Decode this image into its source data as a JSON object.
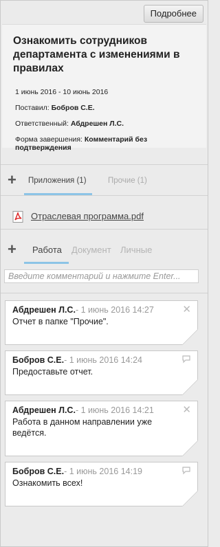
{
  "header": {
    "more_button": "Подробнее"
  },
  "task": {
    "title": "Ознакомить сотрудников департамента с изменениями в правилах",
    "dates": "1 июнь 2016 - 10 июнь 2016",
    "assigned_by_label": "Поставил:",
    "assigned_by": "Бобров С.Е.",
    "responsible_label": "Ответственный:",
    "responsible": "Абдрешен Л.С.",
    "completion_label": "Форма завершения:",
    "completion": "Комментарий без подтверждения"
  },
  "attachments": {
    "tabs": [
      {
        "label": "Приложения (1)",
        "active": true
      },
      {
        "label": "Прочие (1)",
        "active": false
      }
    ],
    "files": [
      {
        "name": "Отраслевая программа.pdf",
        "icon": "pdf-icon"
      }
    ]
  },
  "comments_section": {
    "tabs": [
      {
        "label": "Работа",
        "active": true
      },
      {
        "label": "Документ",
        "active": false
      },
      {
        "label": "Личные",
        "active": false
      }
    ],
    "input_placeholder": "Введите комментарий и нажмите Enter...",
    "items": [
      {
        "author": "Абдрешен Л.С.",
        "sep": "-",
        "date": "1 июнь 2016 14:27",
        "text": "Отчет в папке \"Прочие\".",
        "icon": "close-icon"
      },
      {
        "author": "Бобров С.Е.",
        "sep": "-",
        "date": "1 июнь 2016 14:24",
        "text": "Предоставьте отчет.",
        "icon": "reply-icon"
      },
      {
        "author": "Абдрешен Л.С.",
        "sep": "-",
        "date": "1 июнь 2016 14:21",
        "text": "Работа в данном направлении уже ведётся.",
        "icon": "close-icon"
      },
      {
        "author": "Бобров С.Е.",
        "sep": "-",
        "date": "1 июнь 2016 14:19",
        "text": "Ознакомить всех!",
        "icon": "reply-icon"
      }
    ]
  }
}
